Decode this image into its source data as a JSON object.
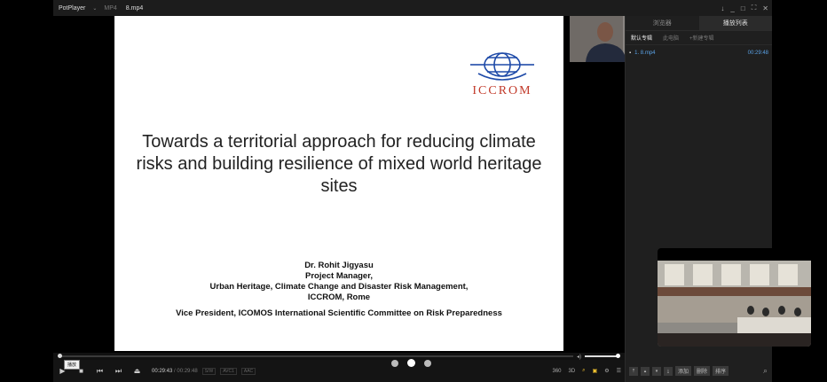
{
  "titlebar": {
    "app_name": "PotPlayer",
    "app_caret": "⌄",
    "format": "MP4",
    "file_name": "8.mp4"
  },
  "window_controls": [
    "↓",
    "_",
    "□",
    "⛶",
    "✕"
  ],
  "slide": {
    "logo_text": "ICCROM",
    "title": "Towards a territorial approach for reducing climate risks and building resilience of mixed world heritage sites",
    "speaker_name": "Dr. Rohit Jigyasu",
    "speaker_role": "Project Manager,",
    "speaker_dept": "Urban Heritage, Climate Change and Disaster Risk Management,",
    "speaker_org": "ICCROM, Rome",
    "speaker_extra": "Vice President, ICOMOS International Scientific Committee on Risk Preparedness"
  },
  "playback": {
    "progress": 0.0,
    "volume": 1.0,
    "current_time": "00:29:43",
    "total_time": "/ 00:29:48",
    "tags": [
      "S/W",
      "AVC1",
      "AAC"
    ],
    "tooltip": "播放",
    "right_labels": [
      "360",
      "3D"
    ]
  },
  "sidebar": {
    "tabs": [
      "浏览器",
      "播放列表"
    ],
    "subtabs": [
      "默认专辑",
      "此电脑",
      "+新建专辑"
    ],
    "items": [
      {
        "name": "1. 8.mp4",
        "duration": "00:29:48"
      }
    ],
    "bottom_buttons": [
      "添加",
      "删除",
      "排序"
    ]
  },
  "colors": {
    "accent": "#f2c230",
    "playlist_blue": "#5aa2e6",
    "logo_red": "#c23a2a"
  }
}
